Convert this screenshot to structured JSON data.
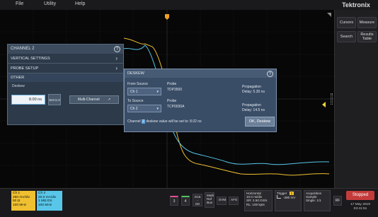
{
  "menu": {
    "file": "File",
    "utility": "Utility",
    "help": "Help"
  },
  "brand": "Tektronix",
  "side_panel": {
    "cursors": "Cursors",
    "measure": "Measure",
    "search": "Search",
    "results_table": "Results Table"
  },
  "channel_panel": {
    "title": "CHANNEL 2",
    "vertical_settings": "VERTICAL SETTINGS",
    "probe_setup": "PROBE SETUP",
    "other": "OTHER",
    "deskew_label": "Deskew",
    "deskew_value": "8.00 ns",
    "set_label": "Set to 0",
    "multi_channel": "Multi-Channel"
  },
  "deskew_dialog": {
    "title": "DESKEW",
    "from_source_label": "From Source",
    "from_source_value": "Ch 1",
    "to_source_label": "To Source",
    "to_source_value": "Ch 2",
    "probe1_label": "Probe",
    "probe1_value": "TDP3500",
    "probe2_label": "Probe",
    "probe2_value": "TCP0030A",
    "prop1_label": "Propagation",
    "prop1_value": "Delay: 5.30 ns",
    "prop2_label": "Propagation",
    "prop2_value": "Delay: 14.5 ns",
    "msg_prefix": "Channel",
    "msg_channel": "2",
    "msg_suffix": "deskew value will be set to: 8.02 ns",
    "ok_button": "OK, Deskew"
  },
  "bottom": {
    "ch1": {
      "title": "Ch 1",
      "line1": "250 mV/div",
      "line2": "50 Ω",
      "line3": "100 MHz"
    },
    "ch2": {
      "title": "Ch 2",
      "line1": "20.0 mA/div",
      "line2": "1 MΩ  DS",
      "line3": "100 MHz"
    },
    "ch3": "3",
    "ch4": "4",
    "d15": "D15 - D0",
    "math": "Math Ref Bus",
    "dvm": "DVM",
    "afg": "AFG",
    "horizontal": {
      "title": "Horizontal",
      "line1": "10.0 ns/div",
      "line2": "SR: 2.50 GS/s",
      "line3": "RL: 100 kpts"
    },
    "trigger": {
      "title": "Trigger",
      "badge": "1",
      "line1": "-380 mV"
    },
    "acquisition": {
      "title": "Acquisition",
      "line1": "Sample",
      "line2": "Single: 1/1"
    },
    "rf": "RF",
    "stopped": "Stopped",
    "date": "17 May 2019",
    "time": "03:41:51"
  },
  "colors": {
    "ch1": "#f0c030",
    "ch2": "#58c6e8",
    "ch3": "#e0508f",
    "stopped": "#c43b3b"
  }
}
